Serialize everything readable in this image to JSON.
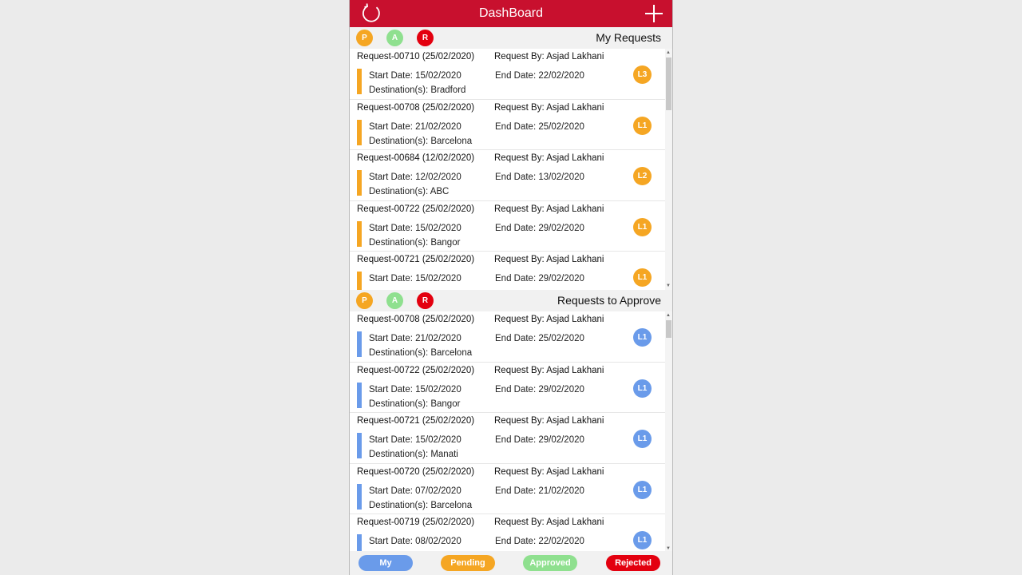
{
  "header": {
    "title": "DashBoard",
    "refresh_icon": "refresh-icon",
    "add_icon": "plus-icon"
  },
  "filters": {
    "p": "P",
    "a": "A",
    "r": "R"
  },
  "my_requests": {
    "title": "My Requests",
    "items": [
      {
        "id": "Request-00710 (25/02/2020)",
        "by": "Request By: Asjad Lakhani",
        "start": "Start Date: 15/02/2020",
        "end": "End Date: 22/02/2020",
        "dest": "Destination(s):  Bradford",
        "level": "L3"
      },
      {
        "id": "Request-00708 (25/02/2020)",
        "by": "Request By: Asjad Lakhani",
        "start": "Start Date: 21/02/2020",
        "end": "End Date: 25/02/2020",
        "dest": "Destination(s):  Barcelona",
        "level": "L1"
      },
      {
        "id": "Request-00684 (12/02/2020)",
        "by": "Request By: Asjad Lakhani",
        "start": "Start Date: 12/02/2020",
        "end": "End Date: 13/02/2020",
        "dest": "Destination(s):  ABC",
        "level": "L2"
      },
      {
        "id": "Request-00722 (25/02/2020)",
        "by": "Request By: Asjad Lakhani",
        "start": "Start Date: 15/02/2020",
        "end": "End Date: 29/02/2020",
        "dest": "Destination(s):  Bangor",
        "level": "L1"
      },
      {
        "id": "Request-00721 (25/02/2020)",
        "by": "Request By: Asjad Lakhani",
        "start": "Start Date: 15/02/2020",
        "end": "End Date: 29/02/2020",
        "dest": "",
        "level": "L1"
      }
    ]
  },
  "to_approve": {
    "title": "Requests to Approve",
    "items": [
      {
        "id": "Request-00708 (25/02/2020)",
        "by": "Request By: Asjad Lakhani",
        "start": "Start Date: 21/02/2020",
        "end": "End Date: 25/02/2020",
        "dest": "Destination(s): Barcelona",
        "level": "L1"
      },
      {
        "id": "Request-00722 (25/02/2020)",
        "by": "Request By: Asjad Lakhani",
        "start": "Start Date: 15/02/2020",
        "end": "End Date: 29/02/2020",
        "dest": "Destination(s): Bangor",
        "level": "L1"
      },
      {
        "id": "Request-00721 (25/02/2020)",
        "by": "Request By: Asjad Lakhani",
        "start": "Start Date: 15/02/2020",
        "end": "End Date: 29/02/2020",
        "dest": "Destination(s): Manati",
        "level": "L1"
      },
      {
        "id": "Request-00720 (25/02/2020)",
        "by": "Request By: Asjad Lakhani",
        "start": "Start Date: 07/02/2020",
        "end": "End Date: 21/02/2020",
        "dest": "Destination(s): Barcelona",
        "level": "L1"
      },
      {
        "id": "Request-00719 (25/02/2020)",
        "by": "Request By: Asjad Lakhani",
        "start": "Start Date: 08/02/2020",
        "end": "End Date: 22/02/2020",
        "dest": "",
        "level": "L1"
      }
    ]
  },
  "bottom": {
    "my": "My",
    "pending": "Pending",
    "approved": "Approved",
    "rejected": "Rejected"
  },
  "colors": {
    "brand": "#c8102e",
    "pending": "#f5a623",
    "approved": "#8fe08f",
    "rejected": "#e3000f",
    "my": "#6a9bea"
  }
}
